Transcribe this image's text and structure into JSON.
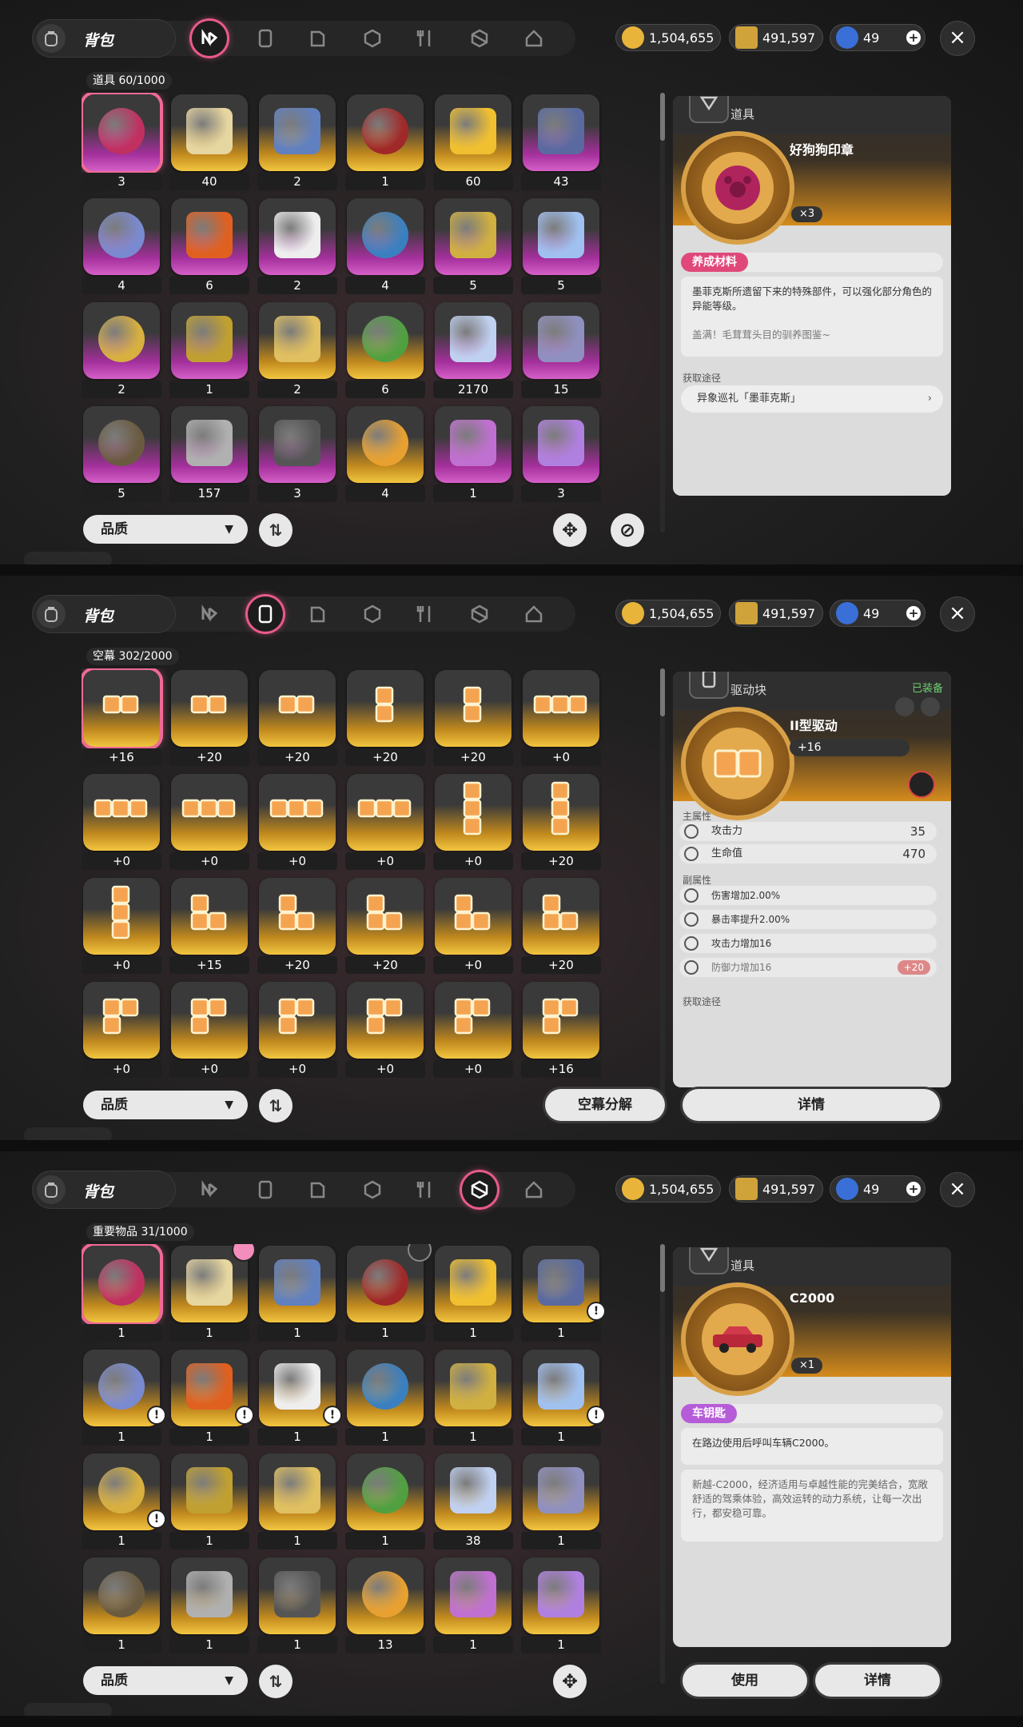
{
  "colors": {
    "accent": "#f06a96",
    "purple_rarity": "#c040b4",
    "gold_rarity": "#f2c640",
    "tag_pink": "#e0487a",
    "tag_purple": "#b65cd8"
  },
  "header": {
    "title": "背包",
    "close_icon": "×"
  },
  "tabs": [
    {
      "icon": "nexus-icon"
    },
    {
      "icon": "device-icon"
    },
    {
      "icon": "book-icon"
    },
    {
      "icon": "box-icon"
    },
    {
      "icon": "utensils-icon"
    },
    {
      "icon": "cube-icon"
    },
    {
      "icon": "home-icon"
    }
  ],
  "currency": {
    "coins": "1,504,655",
    "tickets": "491,597",
    "gems": "49"
  },
  "screens": [
    {
      "active_tab": 0,
      "count_label": "道具  60/1000",
      "items": [
        {
          "qty": "3",
          "rarity": "purple",
          "art": "red seal wax",
          "selected": true
        },
        {
          "qty": "40",
          "rarity": "gold",
          "art": "chess piece"
        },
        {
          "qty": "2",
          "rarity": "gold",
          "art": "thread spool"
        },
        {
          "qty": "1",
          "rarity": "gold",
          "art": "potion flask"
        },
        {
          "qty": "60",
          "rarity": "gold",
          "art": "gold coin"
        },
        {
          "qty": "43",
          "rarity": "purple",
          "art": "cards"
        },
        {
          "qty": "4",
          "rarity": "purple",
          "art": "glass vase"
        },
        {
          "qty": "6",
          "rarity": "purple",
          "art": "flame canister"
        },
        {
          "qty": "2",
          "rarity": "purple",
          "art": "mask"
        },
        {
          "qty": "4",
          "rarity": "purple",
          "art": "dolphin"
        },
        {
          "qty": "5",
          "rarity": "purple",
          "art": "circuit box"
        },
        {
          "qty": "5",
          "rarity": "purple",
          "art": "crystal"
        },
        {
          "qty": "2",
          "rarity": "purple",
          "art": "bird card"
        },
        {
          "qty": "1",
          "rarity": "purple",
          "art": "flower card"
        },
        {
          "qty": "2",
          "rarity": "gold",
          "art": "vase card"
        },
        {
          "qty": "6",
          "rarity": "gold",
          "art": "tin can"
        },
        {
          "qty": "2170",
          "rarity": "purple",
          "art": "crystal tower"
        },
        {
          "qty": "15",
          "rarity": "purple",
          "art": "disc"
        },
        {
          "qty": "5",
          "rarity": "purple",
          "art": "seeds"
        },
        {
          "qty": "157",
          "rarity": "purple",
          "art": "wire spool"
        },
        {
          "qty": "3",
          "rarity": "purple",
          "art": "metal block"
        },
        {
          "qty": "4",
          "rarity": "gold",
          "art": "perfume"
        },
        {
          "qty": "1",
          "rarity": "purple",
          "art": "paint bucket"
        },
        {
          "qty": "3",
          "rarity": "purple",
          "art": "glitch map"
        }
      ],
      "detail": {
        "category": "道具",
        "name": "好狗狗印章",
        "count": "×3",
        "tag": "养成材料",
        "description": "墨菲克斯所遗留下来的特殊部件，可以强化部分角色的异能等级。",
        "flavor": "盖满！毛茸茸头目的驯养图鉴~",
        "source_header": "获取途径",
        "source": "异象巡礼「墨菲克斯」",
        "source_arrow": "›"
      },
      "quality_label": "品质",
      "caret": "▼",
      "sort_icon": "⇅",
      "buttons": {
        "move": "✥",
        "disable": "⊘"
      }
    },
    {
      "active_tab": 1,
      "count_label": "空幕  302/2000",
      "items": [
        {
          "qty": "+16",
          "shape": "h2",
          "selected": true
        },
        {
          "qty": "+20",
          "shape": "h2"
        },
        {
          "qty": "+20",
          "shape": "h2"
        },
        {
          "qty": "+20",
          "shape": "v2"
        },
        {
          "qty": "+20",
          "shape": "v2"
        },
        {
          "qty": "+0",
          "shape": "h3"
        },
        {
          "qty": "+0",
          "shape": "h3"
        },
        {
          "qty": "+0",
          "shape": "h3"
        },
        {
          "qty": "+0",
          "shape": "h3"
        },
        {
          "qty": "+0",
          "shape": "h3"
        },
        {
          "qty": "+0",
          "shape": "v3"
        },
        {
          "qty": "+20",
          "shape": "v3"
        },
        {
          "qty": "+0",
          "shape": "v3"
        },
        {
          "qty": "+15",
          "shape": "L"
        },
        {
          "qty": "+20",
          "shape": "L"
        },
        {
          "qty": "+20",
          "shape": "L"
        },
        {
          "qty": "+0",
          "shape": "L"
        },
        {
          "qty": "+20",
          "shape": "L"
        },
        {
          "qty": "+0",
          "shape": "T"
        },
        {
          "qty": "+0",
          "shape": "T"
        },
        {
          "qty": "+0",
          "shape": "T"
        },
        {
          "qty": "+0",
          "shape": "T"
        },
        {
          "qty": "+0",
          "shape": "T"
        },
        {
          "qty": "+16",
          "shape": "T"
        }
      ],
      "detail": {
        "category": "驱动块",
        "equipped": "已装备",
        "name": "II型驱动",
        "level": "+16",
        "main_header": "主属性",
        "main_stats": [
          {
            "label": "攻击力",
            "value": "35"
          },
          {
            "label": "生命值",
            "value": "470"
          }
        ],
        "sub_header": "副属性",
        "sub_stats": [
          {
            "label": "伤害增加2.00%"
          },
          {
            "label": "暴击率提升2.00%"
          },
          {
            "label": "攻击力增加16"
          },
          {
            "label": "防御力增加16",
            "extra": "+20"
          }
        ],
        "source_header": "获取途径"
      },
      "quality_label": "品质",
      "caret": "▼",
      "sort_icon": "⇅",
      "buttons": {
        "dismantle": "空幕分解",
        "details": "详情"
      }
    },
    {
      "active_tab": 5,
      "count_label": "重要物品  31/1000",
      "items": [
        {
          "qty": "1",
          "rarity": "gold",
          "art": "red car",
          "selected": true
        },
        {
          "qty": "1",
          "rarity": "gold",
          "art": "motorcycle",
          "pink": true
        },
        {
          "qty": "1",
          "rarity": "gold",
          "art": "scooter"
        },
        {
          "qty": "1",
          "rarity": "gold",
          "art": "white car",
          "dark": true
        },
        {
          "qty": "1",
          "rarity": "gold",
          "art": "red motorbike"
        },
        {
          "qty": "1",
          "rarity": "gold",
          "art": "daisy",
          "alert": true
        },
        {
          "qty": "1",
          "rarity": "gold",
          "art": "rose",
          "alert": true
        },
        {
          "qty": "1",
          "rarity": "gold",
          "art": "juice box",
          "alert": true
        },
        {
          "qty": "1",
          "rarity": "gold",
          "art": "ice cream",
          "alert": true
        },
        {
          "qty": "1",
          "rarity": "gold",
          "art": "gold helmet"
        },
        {
          "qty": "1",
          "rarity": "gold",
          "art": "photos"
        },
        {
          "qty": "1",
          "rarity": "gold",
          "art": "star pin",
          "alert": true
        },
        {
          "qty": "1",
          "rarity": "gold",
          "art": "id card",
          "alert": true
        },
        {
          "qty": "1",
          "rarity": "gold",
          "art": "character card"
        },
        {
          "qty": "1",
          "rarity": "gold",
          "art": "key"
        },
        {
          "qty": "1",
          "rarity": "gold",
          "art": "vine ring"
        },
        {
          "qty": "38",
          "rarity": "gold",
          "art": "bronze coin"
        },
        {
          "qty": "1",
          "rarity": "gold",
          "art": "fox mask"
        },
        {
          "qty": "1",
          "rarity": "gold",
          "art": "sunglasses"
        },
        {
          "qty": "1",
          "rarity": "gold",
          "art": "blue card"
        },
        {
          "qty": "1",
          "rarity": "gold",
          "art": "orange card"
        },
        {
          "qty": "13",
          "rarity": "gold",
          "art": "gold key"
        },
        {
          "qty": "1",
          "rarity": "gold",
          "art": "music player"
        },
        {
          "qty": "1",
          "rarity": "gold",
          "art": "skull wallet"
        }
      ],
      "detail": {
        "category": "道具",
        "name": "C2000",
        "count": "×1",
        "tag": "车钥匙",
        "description": "在路边使用后呼叫车辆C2000。",
        "flavor": "新越-C2000，经济适用与卓越性能的完美结合，宽敞舒适的驾乘体验，高效运转的动力系统，让每一次出行，都安稳可靠。"
      },
      "quality_label": "品质",
      "caret": "▼",
      "sort_icon": "⇅",
      "buttons": {
        "move": "✥",
        "use": "使用",
        "details": "详情"
      }
    }
  ]
}
